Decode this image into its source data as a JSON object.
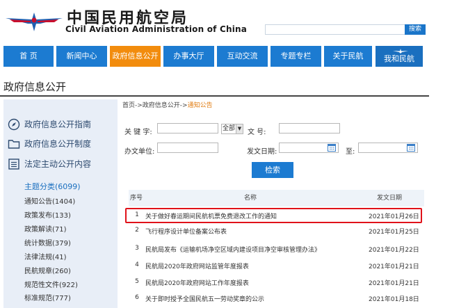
{
  "header": {
    "title_cn": "中国民用航空局",
    "title_en": "Civil Aviation Administration of China",
    "search_placeholder": "",
    "search_button": "搜索"
  },
  "nav": {
    "items": [
      {
        "label": "首 页"
      },
      {
        "label": "新闻中心"
      },
      {
        "label": "政府信息公开"
      },
      {
        "label": "办事大厅"
      },
      {
        "label": "互动交流"
      },
      {
        "label": "专题专栏"
      },
      {
        "label": "关于民航"
      },
      {
        "label": "我和民航"
      }
    ],
    "active_index": 2
  },
  "page_title": "政府信息公开",
  "sidebar": {
    "main_items": [
      {
        "label": "政府信息公开指南",
        "icon": "compass-icon"
      },
      {
        "label": "政府信息公开制度",
        "icon": "folder-icon"
      },
      {
        "label": "法定主动公开内容",
        "icon": "list-icon"
      }
    ],
    "category": "主题分类(6099)",
    "sub_items": [
      "通知公告(1404)",
      "政策发布(133)",
      "政策解读(71)",
      "统计数据(379)",
      "法律法规(41)",
      "民航规章(260)",
      "规范性文件(922)",
      "标准规范(777)"
    ]
  },
  "breadcrumb": {
    "part1": "首页->",
    "part2": "政府信息公开->",
    "current": "通知公告"
  },
  "form": {
    "keyword_label": "关 键 字:",
    "keyword_value": "",
    "scope_select": "全部",
    "doc_no_label": "文    号:",
    "doc_no_value": "",
    "issuer_label": "办文单位:",
    "issuer_value": "",
    "date_label": "发文日期:",
    "date_from": "",
    "date_to_label": "至:",
    "date_to": "",
    "submit_label": "检索"
  },
  "table": {
    "headers": [
      "序号",
      "名称",
      "发文日期"
    ],
    "rows": [
      {
        "no": "1",
        "title": "关于做好春运期间民航机票免费退改工作的通知",
        "date": "2021年01月26日"
      },
      {
        "no": "2",
        "title": "飞行程序设计单位备案公布表",
        "date": "2021年01月25日"
      },
      {
        "no": "3",
        "title": "民航局发布《运输机场净空区域内建设项目净空审核管理办法》",
        "date": "2021年01月22日"
      },
      {
        "no": "4",
        "title": "民航局2020年政府网站监管年度报表",
        "date": "2021年01月21日"
      },
      {
        "no": "5",
        "title": "民航局2020年政府网站工作年度报表",
        "date": "2021年01月21日"
      },
      {
        "no": "6",
        "title": "关于即时授予全国民航五一劳动奖章的公示",
        "date": "2021年01月18日"
      }
    ],
    "highlighted_row": 0
  },
  "colors": {
    "nav_blue": "#1c7bd1",
    "nav_active": "#f28c0d",
    "highlight_border": "#e0121a",
    "sidebar_bg": "#e8eef7"
  }
}
